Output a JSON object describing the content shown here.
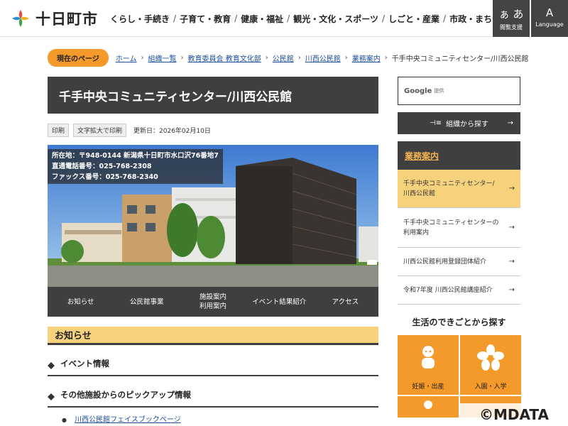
{
  "header": {
    "logo_text": "十日町市",
    "nav": [
      "くらし・手続き",
      "子育て・教育",
      "健康・福祉",
      "観光・文化・スポーツ",
      "しごと・産業",
      "市政・まちづくり"
    ],
    "reading_big": "ぁ あ",
    "reading_small": "閲覧支援",
    "lang_big": "A",
    "lang_small": "Language"
  },
  "breadcrumb": {
    "current_label": "現在のページ",
    "links": [
      "ホーム",
      "組織一覧",
      "教育委員会 教育文化部",
      "公民館",
      "川西公民館",
      "業務案内"
    ],
    "current": "千手中央コミュニティセンター/川西公民館"
  },
  "main": {
    "title": "千手中央コミュニティセンター/川西公民館",
    "print_label": "印刷",
    "large_print_label": "文字拡大で印刷",
    "updated": "更新日：2026年02月10日",
    "hero_info": {
      "address": "所在地：〒948-0144 新潟県十日町市水口沢76番地7",
      "phone": "直通電話番号：025-768-2308",
      "fax": "ファックス番号：025-768-2340"
    },
    "tabs": [
      "お知らせ",
      "公民館事業",
      "施設案内\n利用案内",
      "イベント結果紹介",
      "アクセス"
    ],
    "notice_heading": "お知らせ",
    "section1": "イベント情報",
    "section2": "その他施設からのピックアップ情報",
    "link1": "川西公民館フェイスブックページ"
  },
  "side": {
    "search_google": "Google",
    "search_note": "提供",
    "org_button": "組織から探す",
    "nav_heading": "業務案内",
    "nav_items": [
      "千手中央コミュニティセンター/川西公民館",
      "千手中央コミュニティセンターの利用案内",
      "川西公民館利用登録団体紹介",
      "令和7年度 川西公民館講座紹介"
    ],
    "life_heading": "生活のできごとから探す",
    "life_items": [
      "妊娠・出産",
      "入園・入学"
    ]
  },
  "watermark": "©MDATA",
  "colors": {
    "accent_orange": "#f39a2a",
    "dark": "#3f3f3f",
    "pale_yellow": "#f7d27d",
    "link": "#1a4d9c"
  }
}
